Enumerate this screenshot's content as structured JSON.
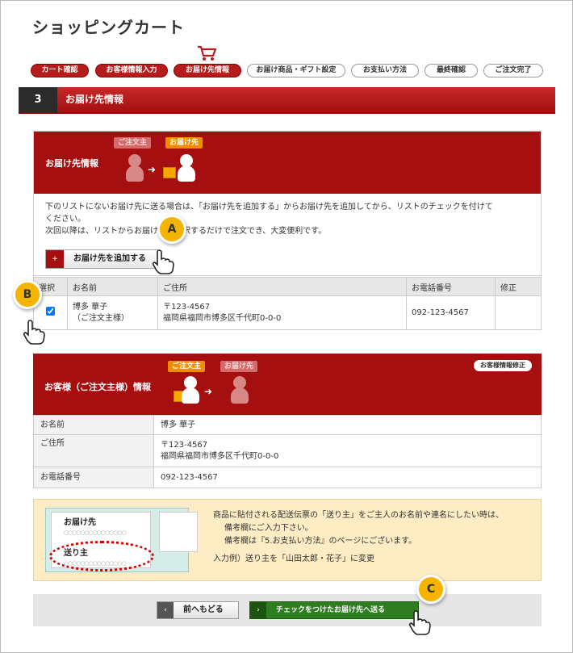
{
  "page": {
    "title": "ショッピングカート"
  },
  "steps": [
    {
      "label": "カート確認",
      "state": "done"
    },
    {
      "label": "お客様情報入力",
      "state": "done"
    },
    {
      "label": "お届け先情報",
      "state": "done"
    },
    {
      "label": "お届け商品・ギフト設定",
      "state": "todo"
    },
    {
      "label": "お支払い方法",
      "state": "todo"
    },
    {
      "label": "最終確認",
      "state": "todo"
    },
    {
      "label": "ご注文完了",
      "state": "todo"
    }
  ],
  "section": {
    "number": "3",
    "title": "お届け先情報"
  },
  "delivery_panel": {
    "title": "お届け先情報",
    "tag_orderer": "ご注文主",
    "tag_recipient": "お届け先",
    "instruction_line1": "下のリストにないお届け先に送る場合は、「お届け先を追加する」からお届け先を追加してから、リストのチェックを付けて",
    "instruction_line2": "ください。",
    "instruction_line3": "次回以降は、リストからお届け先を選択するだけで注文でき、大変便利です。",
    "add_button_label": "お届け先を追加する",
    "add_button_icon": "+"
  },
  "address_table": {
    "headers": [
      "選択",
      "お名前",
      "ご住所",
      "お電話番号",
      "修正"
    ],
    "rows": [
      {
        "name": "博多 華子",
        "name_note": "（ご注文主様）",
        "postal": "〒123-4567",
        "address": "福岡県福岡市博多区千代町0-0-0",
        "phone": "092-123-4567"
      }
    ]
  },
  "customer_panel": {
    "title": "お客様（ご注文主様）情報",
    "tag_orderer": "ご注文主",
    "tag_recipient": "お届け先",
    "modify_button_label": "お客様情報修正",
    "rows": [
      {
        "label": "お名前",
        "value": "博多 華子"
      },
      {
        "label": "ご住所",
        "value": "〒123-4567",
        "value2": "福岡県福岡市博多区千代町0-0-0"
      },
      {
        "label": "お電話番号",
        "value": "092-123-4567"
      }
    ]
  },
  "note": {
    "slip_recipient": "お届け先",
    "slip_sender": "送り主",
    "slip_placeholder": "○○○○○○○○○○○○○○○",
    "line1": "商品に貼付される配送伝票の「送り主」をご主人のお名前や連名にしたい時は、",
    "line2": "備考欄にご入力下さい。",
    "line3": "備考欄は『5.お支払い方法』のページにございます。",
    "line4": "入力例）送り主を「山田太郎・花子」に変更"
  },
  "buttons": {
    "back_label": "前へもどる",
    "back_icon": "‹",
    "next_label": "チェックをつけたお届け先へ送る",
    "next_icon": "›"
  },
  "annotations": {
    "a": "A",
    "b": "B",
    "c": "C"
  },
  "colors": {
    "accent_red": "#a50f0f",
    "highlight_orange": "#f08c00",
    "next_green": "#2e7d1f",
    "badge_yellow": "#f5b400"
  }
}
